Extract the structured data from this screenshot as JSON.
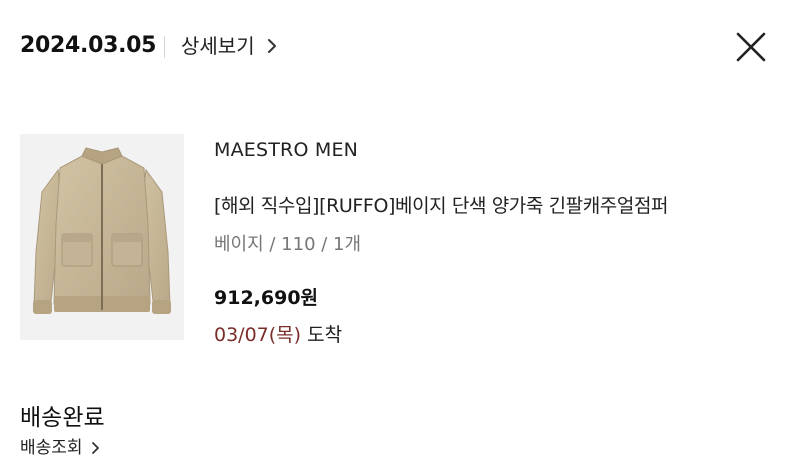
{
  "header": {
    "order_date": "2024.03.05",
    "detail_label": "상세보기"
  },
  "product": {
    "brand": "MAESTRO MEN",
    "name": "[해외 직수입][RUFFO]베이지 단색 양가죽 긴팔캐주얼점퍼",
    "options": "베이지 / 110 / 1개",
    "price": "912,690원",
    "arrival_date": "03/07(목)",
    "arrival_label": "도착"
  },
  "shipping": {
    "status": "배송완료",
    "track_label": "배송조회"
  },
  "icons": {
    "detail": "chevron-right-icon",
    "close": "close-icon",
    "track": "chevron-right-icon"
  },
  "colors": {
    "text": "#111111",
    "muted": "#777777",
    "arrival_date": "#7a2e2a",
    "divider": "#d6d6d6"
  }
}
